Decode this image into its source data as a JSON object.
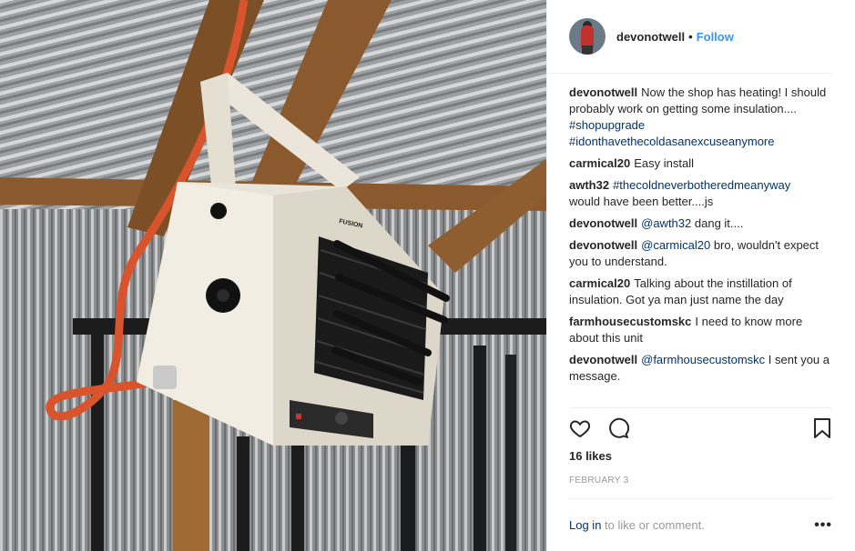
{
  "post": {
    "username": "devonotwell",
    "separator": "•",
    "follow_label": "Follow"
  },
  "comments": [
    {
      "user": "devonotwell",
      "text": "Now the shop has heating! I should probably work on getting some insulation.... ",
      "tags": [
        "#shopupgrade",
        "#idonthavethecoldasanexcuseanymore"
      ]
    },
    {
      "user": "carmical20",
      "text": "Easy install"
    },
    {
      "user": "awth32",
      "mention": "#thecoldneverbotheredmeanyway",
      "text": "would have been better....js"
    },
    {
      "user": "devonotwell",
      "mention": "@awth32",
      "text": "dang it...."
    },
    {
      "user": "devonotwell",
      "mention": "@carmical20",
      "text": "bro, wouldn't expect you to understand."
    },
    {
      "user": "carmical20",
      "text": "Talking about the instillation of insulation. Got ya man just name the day"
    },
    {
      "user": "farmhousecustomskc",
      "text": "I need to know more about this unit"
    },
    {
      "user": "devonotwell",
      "mention": "@farmhousecustomskc",
      "text": "I sent you a message."
    }
  ],
  "actions": {
    "like_icon": "heart-icon",
    "comment_icon": "comment-icon",
    "save_icon": "bookmark-icon"
  },
  "likes": "16 likes",
  "date": "FEBRUARY 3",
  "footer": {
    "login_label": "Log in",
    "login_suffix": " to like or comment.",
    "more_label": "•••"
  },
  "photo": {
    "brand_text": "FUSION"
  }
}
